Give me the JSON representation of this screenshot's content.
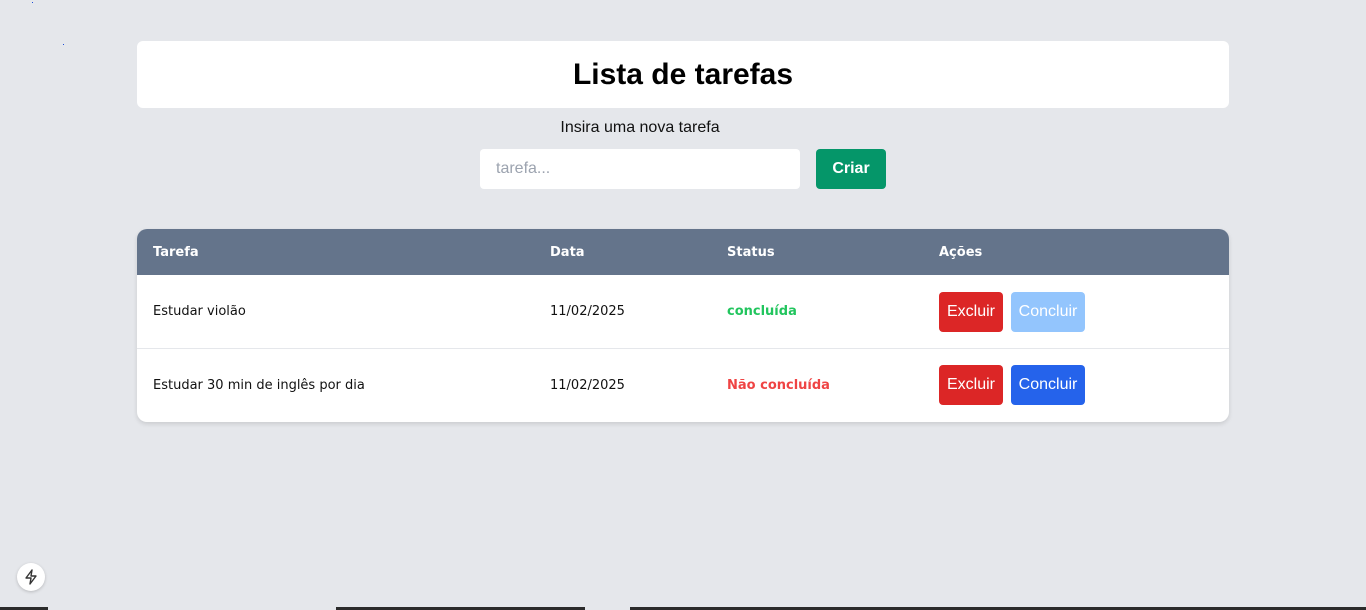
{
  "header": {
    "title": "Lista de tarefas"
  },
  "form": {
    "label": "Insira uma nova tarefa",
    "placeholder": "tarefa...",
    "value": "",
    "create_label": "Criar"
  },
  "table": {
    "columns": [
      "Tarefa",
      "Data",
      "Status",
      "Ações"
    ],
    "rows": [
      {
        "task": "Estudar violão",
        "date": "11/02/2025",
        "status": "concluída",
        "status_color": "#22c55e",
        "delete_label": "Excluir",
        "complete_label": "Concluir",
        "complete_disabled": true
      },
      {
        "task": "Estudar 30 min de inglês por dia",
        "date": "11/02/2025",
        "status": "Não concluída",
        "status_color": "#ef4444",
        "delete_label": "Excluir",
        "complete_label": "Concluir",
        "complete_disabled": false
      }
    ]
  },
  "icons": {
    "devtools": "lightning-bolt-icon"
  },
  "colors": {
    "background": "#e5e7eb",
    "table_header": "#64748b",
    "create_button": "#059669",
    "delete_button": "#dc2626",
    "complete_button": "#2563eb",
    "complete_button_disabled": "#93c5fd"
  }
}
